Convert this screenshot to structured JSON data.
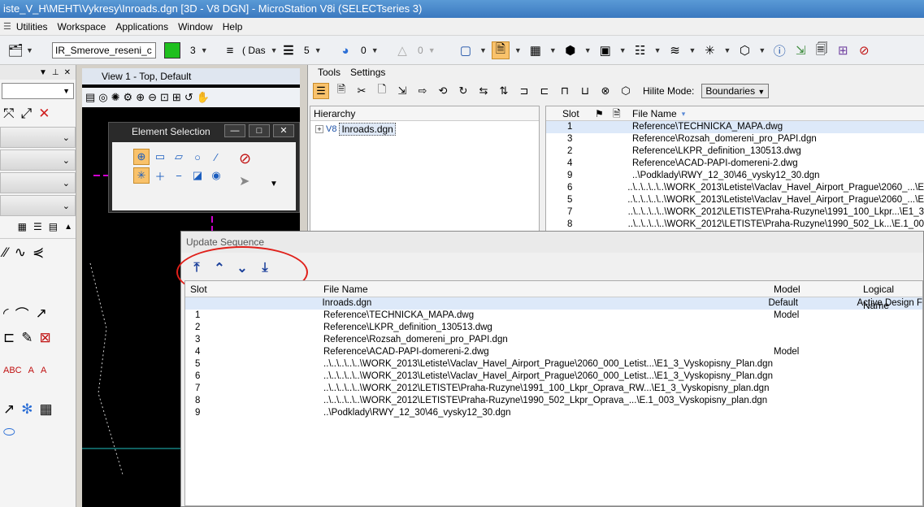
{
  "window": {
    "title": "iste_V_H\\MEHT\\Vykresy\\Inroads.dgn [3D - V8 DGN] - MicroStation V8i (SELECTseries 3)"
  },
  "menu": [
    "Utilities",
    "Workspace",
    "Applications",
    "Window",
    "Help"
  ],
  "toolbar": {
    "level_combo": "IR_Smerove_reseni_c",
    "color_value": "3",
    "linestyle_value": "( Das",
    "weight_value": "5",
    "transparency_value": "0",
    "priority_value": "0"
  },
  "view": {
    "title": "View 1 - Top, Default"
  },
  "element_selection": {
    "title": "Element Selection"
  },
  "references": {
    "menu": [
      "Tools",
      "Settings"
    ],
    "hilite_label": "Hilite Mode:",
    "hilite_value": "Boundaries",
    "hierarchy_header": "Hierarchy",
    "hierarchy_root": "Inroads.dgn",
    "columns": {
      "slot": "Slot",
      "file_name": "File Name"
    },
    "rows": [
      {
        "slot": "1",
        "file": "Reference\\TECHNICKA_MAPA.dwg"
      },
      {
        "slot": "3",
        "file": "Reference\\Rozsah_domereni_pro_PAPI.dgn"
      },
      {
        "slot": "2",
        "file": "Reference\\LKPR_definition_130513.dwg"
      },
      {
        "slot": "4",
        "file": "Reference\\ACAD-PAPI-domereni-2.dwg"
      },
      {
        "slot": "9",
        "file": "..\\Podklady\\RWY_12_30\\46_vysky12_30.dgn"
      },
      {
        "slot": "6",
        "file": "..\\..\\..\\..\\..\\WORK_2013\\Letiste\\Vaclav_Havel_Airport_Prague\\2060_...\\E"
      },
      {
        "slot": "5",
        "file": "..\\..\\..\\..\\..\\WORK_2013\\Letiste\\Vaclav_Havel_Airport_Prague\\2060_...\\E"
      },
      {
        "slot": "7",
        "file": "..\\..\\..\\..\\..\\WORK_2012\\LETISTE\\Praha-Ruzyne\\1991_100_Lkpr...\\E1_3"
      },
      {
        "slot": "8",
        "file": "..\\..\\..\\..\\..\\WORK_2012\\LETISTE\\Praha-Ruzyne\\1990_502_Lk...\\E.1_00"
      }
    ]
  },
  "update_sequence": {
    "title": "Update Sequence",
    "columns": {
      "slot": "Slot",
      "file_name": "File Name",
      "model": "Model",
      "logical_name": "Logical Name"
    },
    "rows": [
      {
        "slot": "",
        "file": "Inroads.dgn",
        "model": "Default",
        "logical": "Active Design F"
      },
      {
        "slot": "1",
        "file": "Reference\\TECHNICKA_MAPA.dwg",
        "model": "Model",
        "logical": ""
      },
      {
        "slot": "2",
        "file": "Reference\\LKPR_definition_130513.dwg",
        "model": "",
        "logical": ""
      },
      {
        "slot": "3",
        "file": "Reference\\Rozsah_domereni_pro_PAPI.dgn",
        "model": "",
        "logical": ""
      },
      {
        "slot": "4",
        "file": "Reference\\ACAD-PAPI-domereni-2.dwg",
        "model": "Model",
        "logical": ""
      },
      {
        "slot": "5",
        "file": "..\\..\\..\\..\\..\\WORK_2013\\Letiste\\Vaclav_Havel_Airport_Prague\\2060_000_Letist...\\E1_3_Vyskopisny_Plan.dgn",
        "model": "",
        "logical": ""
      },
      {
        "slot": "6",
        "file": "..\\..\\..\\..\\..\\WORK_2013\\Letiste\\Vaclav_Havel_Airport_Prague\\2060_000_Letist...\\E1_3_Vyskopisny_Plan.dgn",
        "model": "",
        "logical": ""
      },
      {
        "slot": "7",
        "file": "..\\..\\..\\..\\..\\WORK_2012\\LETISTE\\Praha-Ruzyne\\1991_100_Lkpr_Oprava_RW...\\E1_3_Vyskopisny_plan.dgn",
        "model": "",
        "logical": ""
      },
      {
        "slot": "8",
        "file": "..\\..\\..\\..\\..\\WORK_2012\\LETISTE\\Praha-Ruzyne\\1990_502_Lkpr_Oprava_...\\E.1_003_Vyskopisny_plan.dgn",
        "model": "",
        "logical": ""
      },
      {
        "slot": "9",
        "file": "..\\Podklady\\RWY_12_30\\46_vysky12_30.dgn",
        "model": "",
        "logical": ""
      }
    ]
  }
}
